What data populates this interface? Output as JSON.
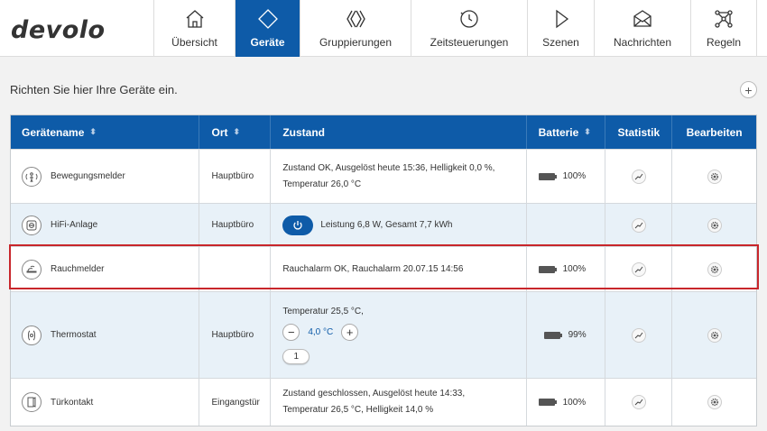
{
  "brand": {
    "logo_text": "devolo"
  },
  "nav": [
    {
      "label": "Übersicht",
      "icon": "home-icon",
      "active": false
    },
    {
      "label": "Geräte",
      "icon": "diamond-icon",
      "active": true
    },
    {
      "label": "Gruppierungen",
      "icon": "group-icon",
      "active": false
    },
    {
      "label": "Zeitsteuerungen",
      "icon": "clock-icon",
      "active": false
    },
    {
      "label": "Szenen",
      "icon": "play-icon",
      "active": false
    },
    {
      "label": "Nachrichten",
      "icon": "envelope-icon",
      "active": false
    },
    {
      "label": "Regeln",
      "icon": "rules-icon",
      "active": false
    }
  ],
  "page": {
    "subtitle": "Richten Sie hier Ihre Geräte ein.",
    "add_label": "+"
  },
  "table": {
    "headers": {
      "name": "Gerätename",
      "location": "Ort",
      "state": "Zustand",
      "battery": "Batterie",
      "stats": "Statistik",
      "edit": "Bearbeiten",
      "sort_glyph": "⬍"
    },
    "rows": [
      {
        "name": "Bewegungsmelder",
        "location": "Hauptbüro",
        "state_line1": "Zustand OK,  Ausgelöst heute 15:36,  Helligkeit 0,0 %,",
        "state_line2": "Temperatur 26,0 °C",
        "battery": "100%"
      },
      {
        "name": "HiFi-Anlage",
        "location": "Hauptbüro",
        "state": "Leistung 6,8 W,  Gesamt 7,7 kWh",
        "battery": ""
      },
      {
        "name": "Rauchmelder",
        "location": "",
        "state": "Rauchalarm OK,  Rauchalarm 20.07.15 14:56",
        "battery": "100%"
      },
      {
        "name": "Thermostat",
        "location": "Hauptbüro",
        "state": "Temperatur 25,5 °C,",
        "setpoint": "4,0 °C",
        "minus": "−",
        "plus": "+",
        "mode_value": "1",
        "battery": "99%"
      },
      {
        "name": "Türkontakt",
        "location": "Eingangstür",
        "state_line1": "Zustand geschlossen,  Ausgelöst heute 14:33,",
        "state_line2": "Temperatur 26,5 °C,  Helligkeit 14,0 %",
        "battery": "100%"
      }
    ]
  },
  "colors": {
    "primary": "#0e5ba8",
    "highlight": "#c8262b",
    "row_alt": "#e8f1f8"
  }
}
